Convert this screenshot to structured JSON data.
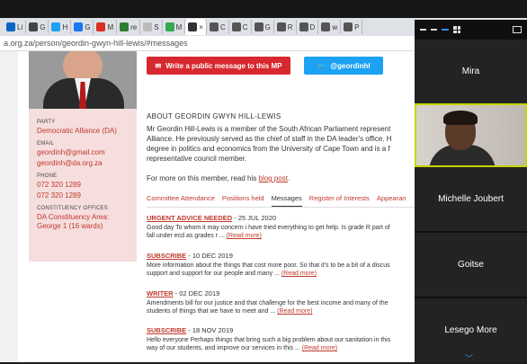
{
  "browser": {
    "tabs": [
      {
        "label": "Li",
        "color": "#0a66c2"
      },
      {
        "label": "G",
        "color": "#444444"
      },
      {
        "label": "H",
        "color": "#1da1f2"
      },
      {
        "label": "G",
        "color": "#1877f2"
      },
      {
        "label": "M",
        "color": "#d93025"
      },
      {
        "label": "re",
        "color": "#2e7d32"
      },
      {
        "label": "S",
        "color": "#bbbbbb"
      },
      {
        "label": "M",
        "color": "#34a853"
      },
      {
        "label": "",
        "color": "#333333",
        "active": true
      },
      {
        "label": "C",
        "color": "#555555"
      },
      {
        "label": "C",
        "color": "#555555"
      },
      {
        "label": "G",
        "color": "#555555"
      },
      {
        "label": "R",
        "color": "#555555"
      },
      {
        "label": "D",
        "color": "#555555"
      },
      {
        "label": "w",
        "color": "#555555"
      },
      {
        "label": "P",
        "color": "#555555"
      }
    ],
    "close_glyph": "×",
    "url": "a.org.za/person/geordin-gwyn-hill-lewis/#messages"
  },
  "profile": {
    "party_label": "PARTY",
    "party": "Democratic Alliance (DA)",
    "email_label": "EMAIL",
    "emails": [
      "geordinh@gmail.com",
      "geordinh@da.org.za"
    ],
    "phone_label": "PHONE",
    "phones": [
      "072 320 1289",
      "072 320 1289"
    ],
    "offices_label": "CONSTITUENCY OFFICES",
    "office": "DA Constituency Area: George 1 (16 wards)"
  },
  "actions": {
    "write_message": "Write a public message to this MP",
    "twitter": "@geordinhl"
  },
  "about": {
    "heading": "ABOUT GEORDIN GWYN HILL-LEWIS",
    "lines": [
      "Mr Geordin Hill-Lewis is a member of the South African Parliament represent",
      "Alliance. He previously served as the chief of staff in the DA leader's office. H",
      "degree in politics and economics from the University of Cape Town and is a f",
      "representative council member."
    ],
    "blog_prefix": "For more on this member, read his ",
    "blog_link": "blog post",
    "blog_suffix": "."
  },
  "tabs": [
    {
      "label": "Committee Attendance"
    },
    {
      "label": "Positions held"
    },
    {
      "label": "Messages",
      "current": true
    },
    {
      "label": "Register of Interests"
    },
    {
      "label": "Appearan"
    }
  ],
  "messages": [
    {
      "title": "URGENT ADVICE NEEDED",
      "date": " - 25 JUL 2020",
      "line1": "Good day To whom it may concern i have tried everything to get help. Is grade R part of",
      "line2": "fall under ecd as grades r ... ",
      "more": "(Read more)"
    },
    {
      "title": "SUBSCRIBE",
      "date": " - 10 DEC 2019",
      "line1": "More information about the things that cost more poor. So that it's to be a bit of a discus",
      "line2": "support and support for our people and many ... ",
      "more": "(Read more)"
    },
    {
      "title": "WRITER",
      "date": " - 02 DEC 2019",
      "line1": "Amendments bill for our justice and that challenge for the best income and many of the",
      "line2": "students of things that we have to meet and ... ",
      "more": "(Read more)"
    },
    {
      "title": "SUBSCRIBE",
      "date": " - 18 NOV 2019",
      "line1": "Hello everyone Perhaps things that bring such a big problem about our sanitation in this",
      "line2": "way of our students, and improve our services in this ... ",
      "more": "(Read more)"
    }
  ],
  "participants": [
    {
      "name": "Mira"
    },
    {
      "name": ""
    },
    {
      "name": "Michelle Joubert"
    },
    {
      "name": "Goitse"
    },
    {
      "name": "Lesego More"
    }
  ],
  "colors": {
    "accent_red": "#c0392b",
    "button_red": "#d7282f",
    "twitter_blue": "#1da1f2",
    "speaker_highlight": "#c8d400"
  }
}
